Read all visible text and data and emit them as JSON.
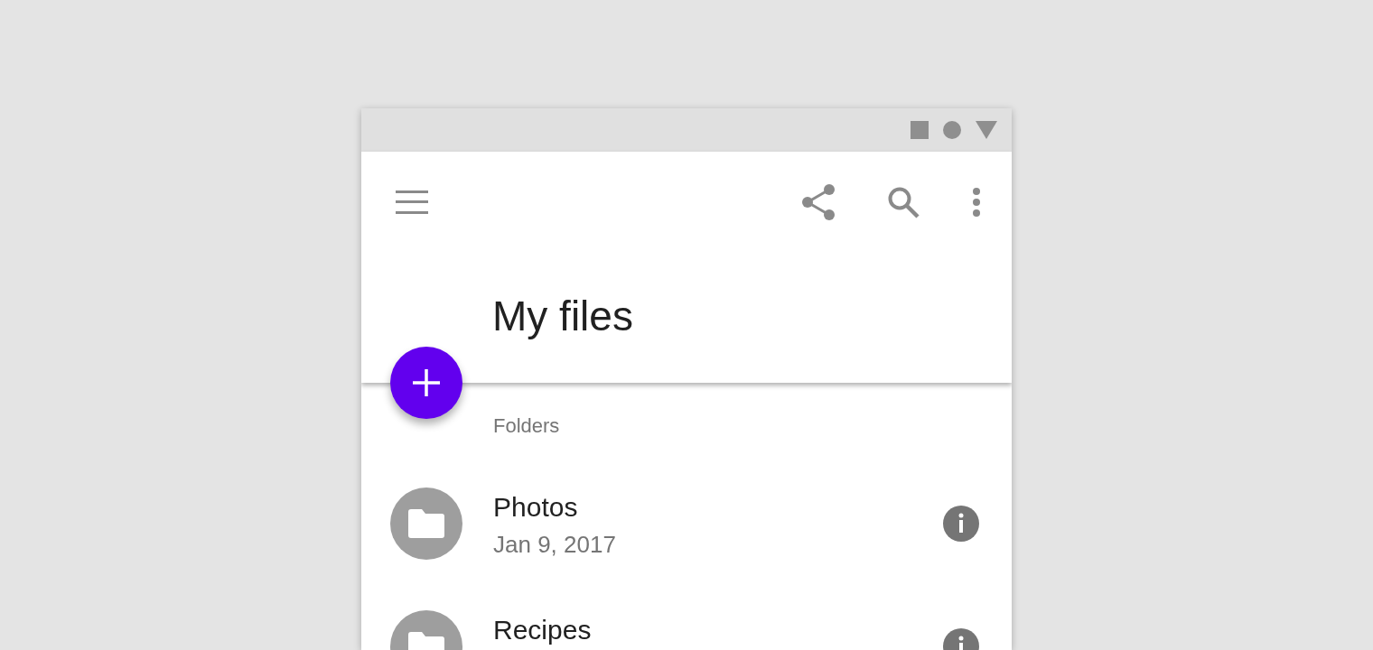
{
  "app_bar": {
    "title": "My files"
  },
  "section_header": "Folders",
  "folders": [
    {
      "name": "Photos",
      "date": "Jan 9, 2017"
    },
    {
      "name": "Recipes"
    }
  ]
}
